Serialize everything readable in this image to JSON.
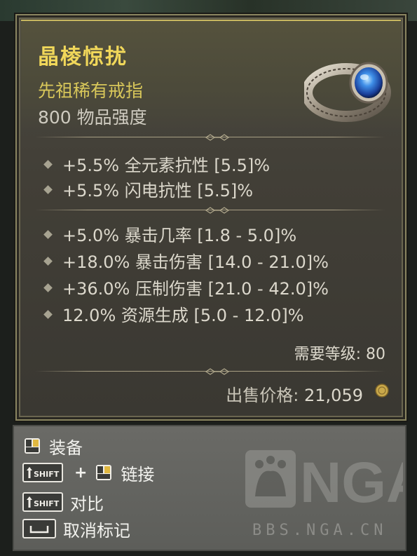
{
  "item": {
    "name": "晶棱惊扰",
    "type": "先祖稀有戒指",
    "power": "800 物品强度"
  },
  "affixes_implicit": [
    "+5.5% 全元素抗性 [5.5]%",
    "+5.5% 闪电抗性 [5.5]%"
  ],
  "affixes_explicit": [
    "+5.0% 暴击几率 [1.8 - 5.0]%",
    "+18.0% 暴击伤害 [14.0 - 21.0]%",
    "+36.0% 压制伤害 [21.0 - 42.0]%",
    "12.0% 资源生成 [5.0 - 12.0]%"
  ],
  "requirement": "需要等级: 80",
  "sell": {
    "label": "出售价格:",
    "value": "21,059"
  },
  "controls": {
    "equip": "装备",
    "link": "链接",
    "compare": "对比",
    "unmark": "取消标记",
    "shift_key": "SHIFT",
    "plus": "+"
  },
  "watermark": {
    "logo": "NGA",
    "url": "BBS.NGA.CN"
  },
  "colors": {
    "legendary_name": "#f0d75a",
    "rarity_type": "#d8c75a",
    "stat_text": "#dcd8cc"
  }
}
